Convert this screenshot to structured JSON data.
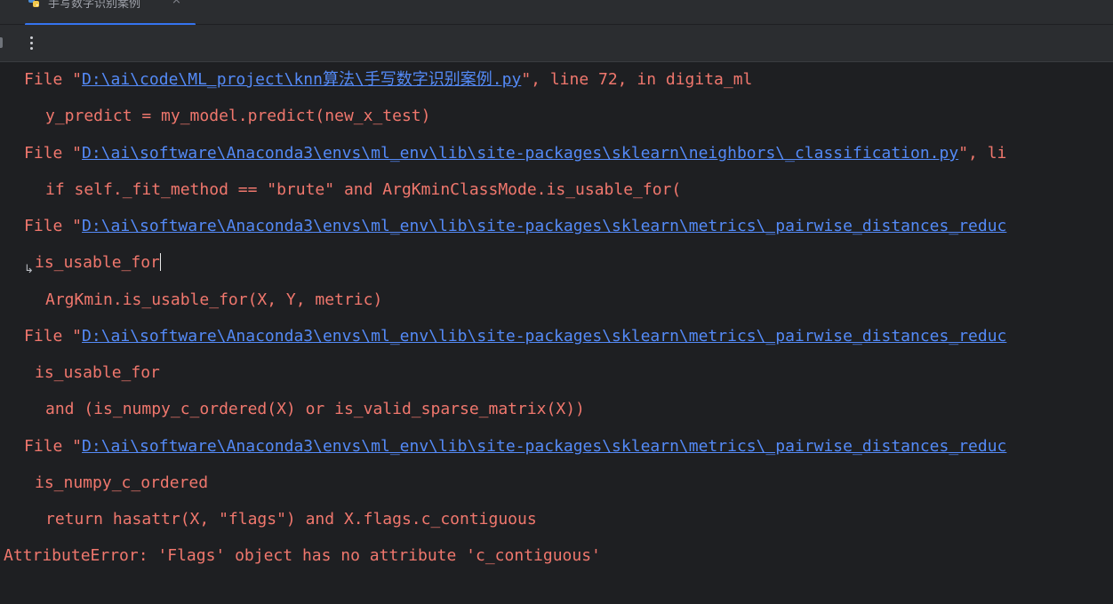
{
  "tab": {
    "title": "手写数字识别案例",
    "close_glyph": "×",
    "icon": "python-file-icon"
  },
  "toolbar": {
    "more_icon": "kebab-menu-icon"
  },
  "console": {
    "wrap_marker": "↳",
    "lines": [
      {
        "pre": "File \"",
        "link": "D:\\ai\\code\\ML_project\\knn算法\\手写数字识别案例.py",
        "post": "\", line 72, in digita_ml"
      },
      {
        "text": "y_predict = my_model.predict(new_x_test)"
      },
      {
        "pre": "File \"",
        "link": "D:\\ai\\software\\Anaconda3\\envs\\ml_env\\lib\\site-packages\\sklearn\\neighbors\\_classification.py",
        "post": "\", li"
      },
      {
        "text": "if self._fit_method == \"brute\" and ArgKminClassMode.is_usable_for("
      },
      {
        "pre": "File \"",
        "link": "D:\\ai\\software\\Anaconda3\\envs\\ml_env\\lib\\site-packages\\sklearn\\metrics\\_pairwise_distances_reduc",
        "post": ""
      },
      {
        "text": "is_usable_for"
      },
      {
        "text": "ArgKmin.is_usable_for(X, Y, metric)"
      },
      {
        "pre": "File \"",
        "link": "D:\\ai\\software\\Anaconda3\\envs\\ml_env\\lib\\site-packages\\sklearn\\metrics\\_pairwise_distances_reduc",
        "post": ""
      },
      {
        "text": "is_usable_for"
      },
      {
        "text": "and (is_numpy_c_ordered(X) or is_valid_sparse_matrix(X))"
      },
      {
        "pre": "File \"",
        "link": "D:\\ai\\software\\Anaconda3\\envs\\ml_env\\lib\\site-packages\\sklearn\\metrics\\_pairwise_distances_reduc",
        "post": ""
      },
      {
        "text": "is_numpy_c_ordered"
      },
      {
        "text": "return hasattr(X, \"flags\") and X.flags.c_contiguous"
      },
      {
        "text": "AttributeError: 'Flags' object has no attribute 'c_contiguous'"
      }
    ]
  },
  "colors": {
    "error_text": "#f0776d",
    "link": "#548af7",
    "console_bg": "#1e1f22",
    "chrome_bg": "#2b2d30",
    "tab_indicator": "#3574f0"
  }
}
